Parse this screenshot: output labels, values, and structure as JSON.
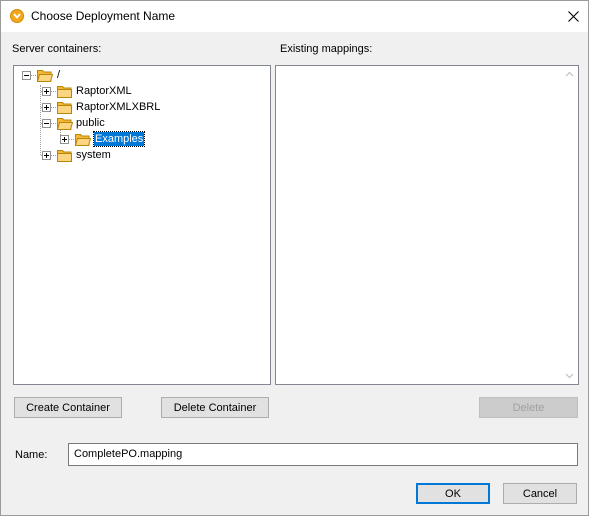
{
  "window": {
    "title": "Choose Deployment Name"
  },
  "labels": {
    "server_containers": "Server containers:",
    "existing_mappings": "Existing mappings:",
    "name": "Name:"
  },
  "tree": {
    "root": "/",
    "items": [
      {
        "label": "RaptorXML",
        "expanded": false
      },
      {
        "label": "RaptorXMLXBRL",
        "expanded": false
      },
      {
        "label": "public",
        "expanded": true
      },
      {
        "label": "Examples",
        "expanded": false,
        "selected": true
      },
      {
        "label": "system",
        "expanded": false
      }
    ]
  },
  "mappings": {
    "items": []
  },
  "buttons": {
    "create_container": "Create Container",
    "delete_container": "Delete Container",
    "delete": "Delete",
    "ok": "OK",
    "cancel": "Cancel"
  },
  "name_field": {
    "value": "CompletePO.mapping"
  },
  "colors": {
    "selection": "#0078d7",
    "folder": "#f5b933",
    "dialog_bg": "#f0f0f0"
  }
}
